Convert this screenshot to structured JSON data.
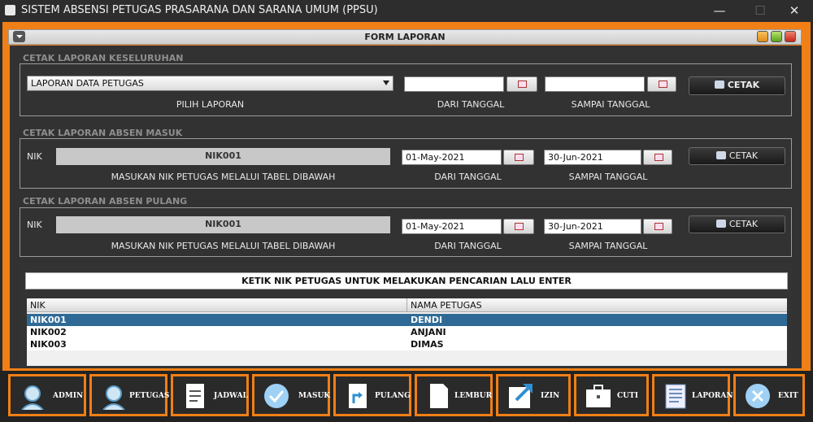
{
  "window": {
    "title": "SISTEM ABSENSI PETUGAS PRASARANA DAN SARANA UMUM (PPSU)",
    "minimize": "—",
    "maximize": "☐",
    "close": "✕"
  },
  "form": {
    "title": "FORM LAPORAN"
  },
  "section1": {
    "title": "CETAK LAPORAN KESELURUHAN",
    "report_select": "LAPORAN DATA PETUGAS",
    "report_caption": "PILIH LAPORAN",
    "from_value": "",
    "from_caption": "DARI TANGGAL",
    "to_value": "",
    "to_caption": "SAMPAI TANGGAL",
    "print_label": "CETAK"
  },
  "section2": {
    "title": "CETAK LAPORAN ABSEN MASUK",
    "nik_label": "NIK",
    "nik_value": "NIK001",
    "nik_caption": "MASUKAN NIK PETUGAS MELALUI TABEL DIBAWAH",
    "from_value": "01-May-2021",
    "from_caption": "DARI TANGGAL",
    "to_value": "30-Jun-2021",
    "to_caption": "SAMPAI TANGGAL",
    "print_label": "CETAK"
  },
  "section3": {
    "title": "CETAK LAPORAN ABSEN PULANG",
    "nik_label": "NIK",
    "nik_value": "NIK001",
    "nik_caption": "MASUKAN NIK PETUGAS MELALUI TABEL DIBAWAH",
    "from_value": "01-May-2021",
    "from_caption": "DARI TANGGAL",
    "to_value": "30-Jun-2021",
    "to_caption": "SAMPAI TANGGAL",
    "print_label": "CETAK"
  },
  "search": {
    "text": "KETIK NIK PETUGAS UNTUK MELAKUKAN PENCARIAN LALU ENTER"
  },
  "table": {
    "headers": [
      "NIK",
      "NAMA PETUGAS"
    ],
    "rows": [
      {
        "nik": "NIK001",
        "name": "DENDI"
      },
      {
        "nik": "NIK002",
        "name": "ANJANI"
      },
      {
        "nik": "NIK003",
        "name": "DIMAS"
      }
    ]
  },
  "nav": [
    {
      "label": "ADMIN",
      "icon": "admin-avatar-icon"
    },
    {
      "label": "PETUGAS",
      "icon": "officer-avatar-icon"
    },
    {
      "label": "JADWAL",
      "icon": "document-icon"
    },
    {
      "label": "MASUK",
      "icon": "checkmark-icon"
    },
    {
      "label": "PULANG",
      "icon": "arrow-out-icon"
    },
    {
      "label": "LEMBUR",
      "icon": "blank-document-icon"
    },
    {
      "label": "IZIN",
      "icon": "arrow-upright-icon"
    },
    {
      "label": "CUTI",
      "icon": "briefcase-icon"
    },
    {
      "label": "LAPORAN",
      "icon": "report-icon"
    },
    {
      "label": "EXIT",
      "icon": "close-circle-icon"
    }
  ],
  "colors": {
    "accent": "#f07f16",
    "background": "#323232",
    "selected_row": "#2f6a97"
  }
}
